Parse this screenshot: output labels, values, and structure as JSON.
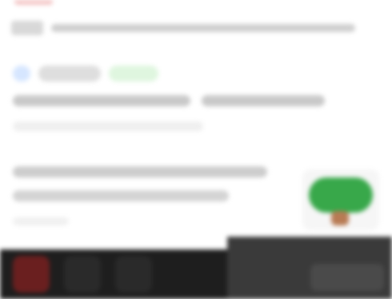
{
  "visible_text": []
}
